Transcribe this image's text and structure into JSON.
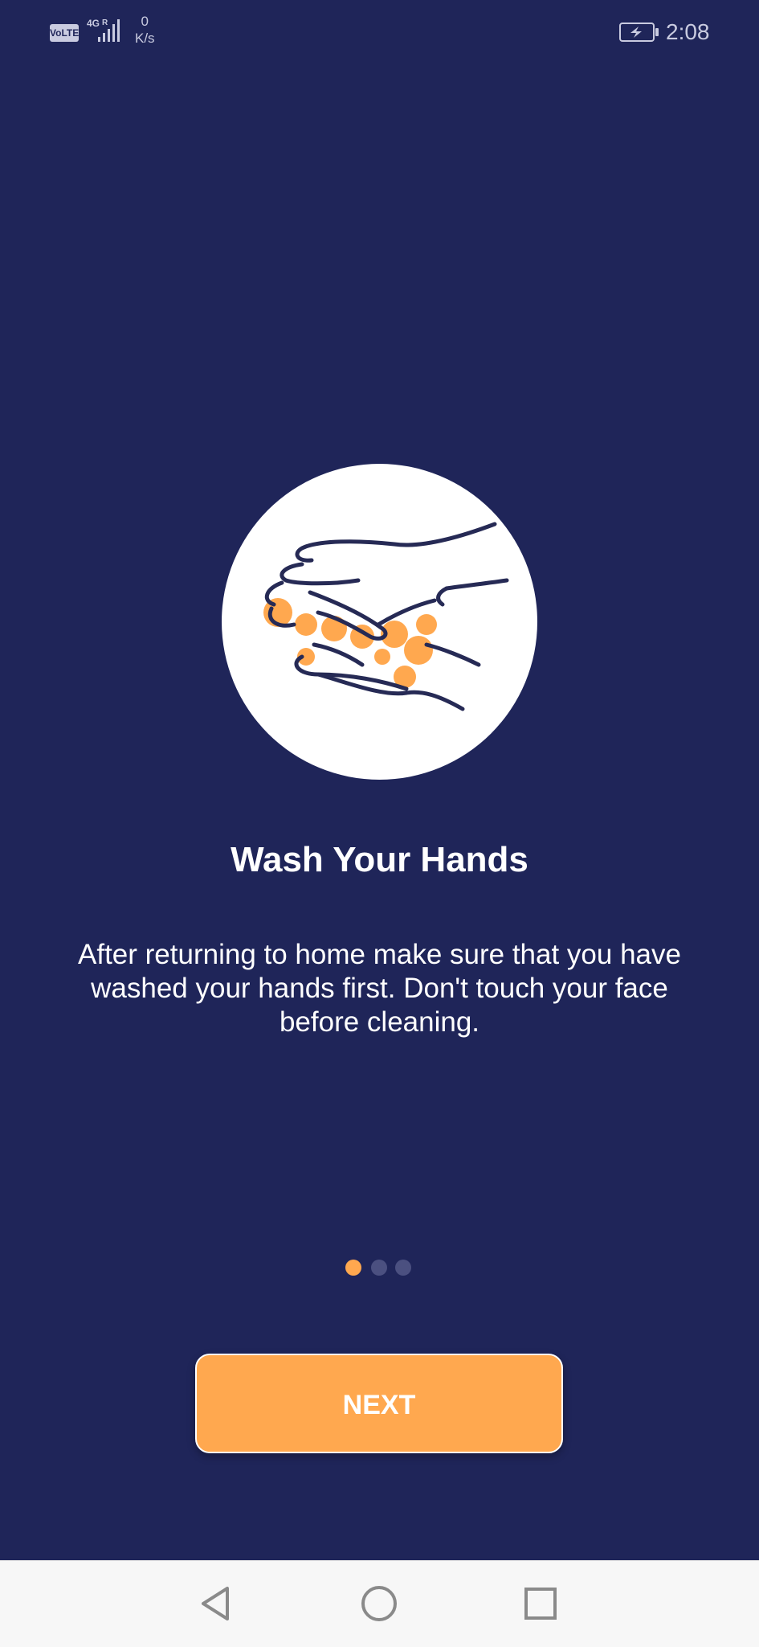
{
  "status_bar": {
    "volte": "VoLTE",
    "network": "4G",
    "roaming": "R",
    "speed_value": "0",
    "speed_unit": "K/s",
    "time": "2:08"
  },
  "onboarding": {
    "title": "Wash Your Hands",
    "description": "After returning to home make sure that you have washed your hands first. Don't touch your face before cleaning.",
    "illustration_icon": "hand-washing-icon",
    "page_indicator": {
      "current_page": 1,
      "total_pages": 3
    },
    "next_label": "NEXT"
  },
  "nav_bar": {
    "back": "back-icon",
    "home": "home-icon",
    "recents": "recents-icon"
  },
  "colors": {
    "background": "#1F2559",
    "accent": "#FFA84F",
    "text": "#FFFFFF",
    "dot_inactive": "#4B5080",
    "nav_bar": "#F7F7F7"
  }
}
